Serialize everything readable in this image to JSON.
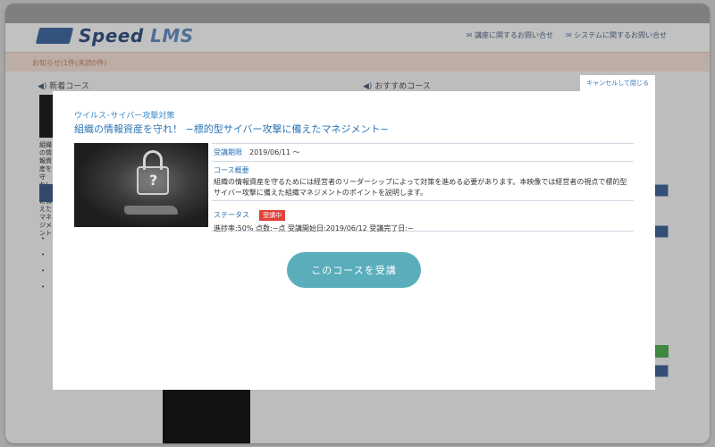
{
  "header": {
    "logo_main": "Speed",
    "logo_sub": "LMS",
    "links": [
      "講座に関するお問い合せ",
      "システムに関するお問い合せ"
    ]
  },
  "notice": {
    "text": "お知らせ(1件(未読0件)"
  },
  "sections": {
    "new_courses": "新着コース",
    "recommended": "おすすめコース"
  },
  "background_snippet": "組織の情報資産を守れ！攻撃に備えたマネジメント",
  "modal": {
    "cancel_label": "キャンセルして閉じる",
    "category": "ウイルス･サイバー攻撃対策",
    "title": "組織の情報資産を守れ！ −標的型サイバー攻撃に備えたマネジメント−",
    "term_label": "受講期限",
    "term_value": "2019/06/11 ～",
    "summary_label": "コース概要",
    "summary_text": "組織の情報資産を守るためには経営者のリーダーシップによって対策を進める必要があります。本映像では経営者の視点で標的型サイバー攻撃に備えた組織マネジメントのポイントを説明します。",
    "status_label": "ステータス",
    "status_badge": "受講中",
    "status_details": "進捗率:50% 点数:−点 受講開始日:2019/06/12 受講完了日:−",
    "enroll_button": "このコースを受講"
  },
  "colors": {
    "accent": "#2b74b5",
    "button": "#5aaebc",
    "badge": "#e0423a"
  },
  "icons": [
    "lock-thumbnail-image",
    "mail-icon",
    "speaker-icon"
  ]
}
